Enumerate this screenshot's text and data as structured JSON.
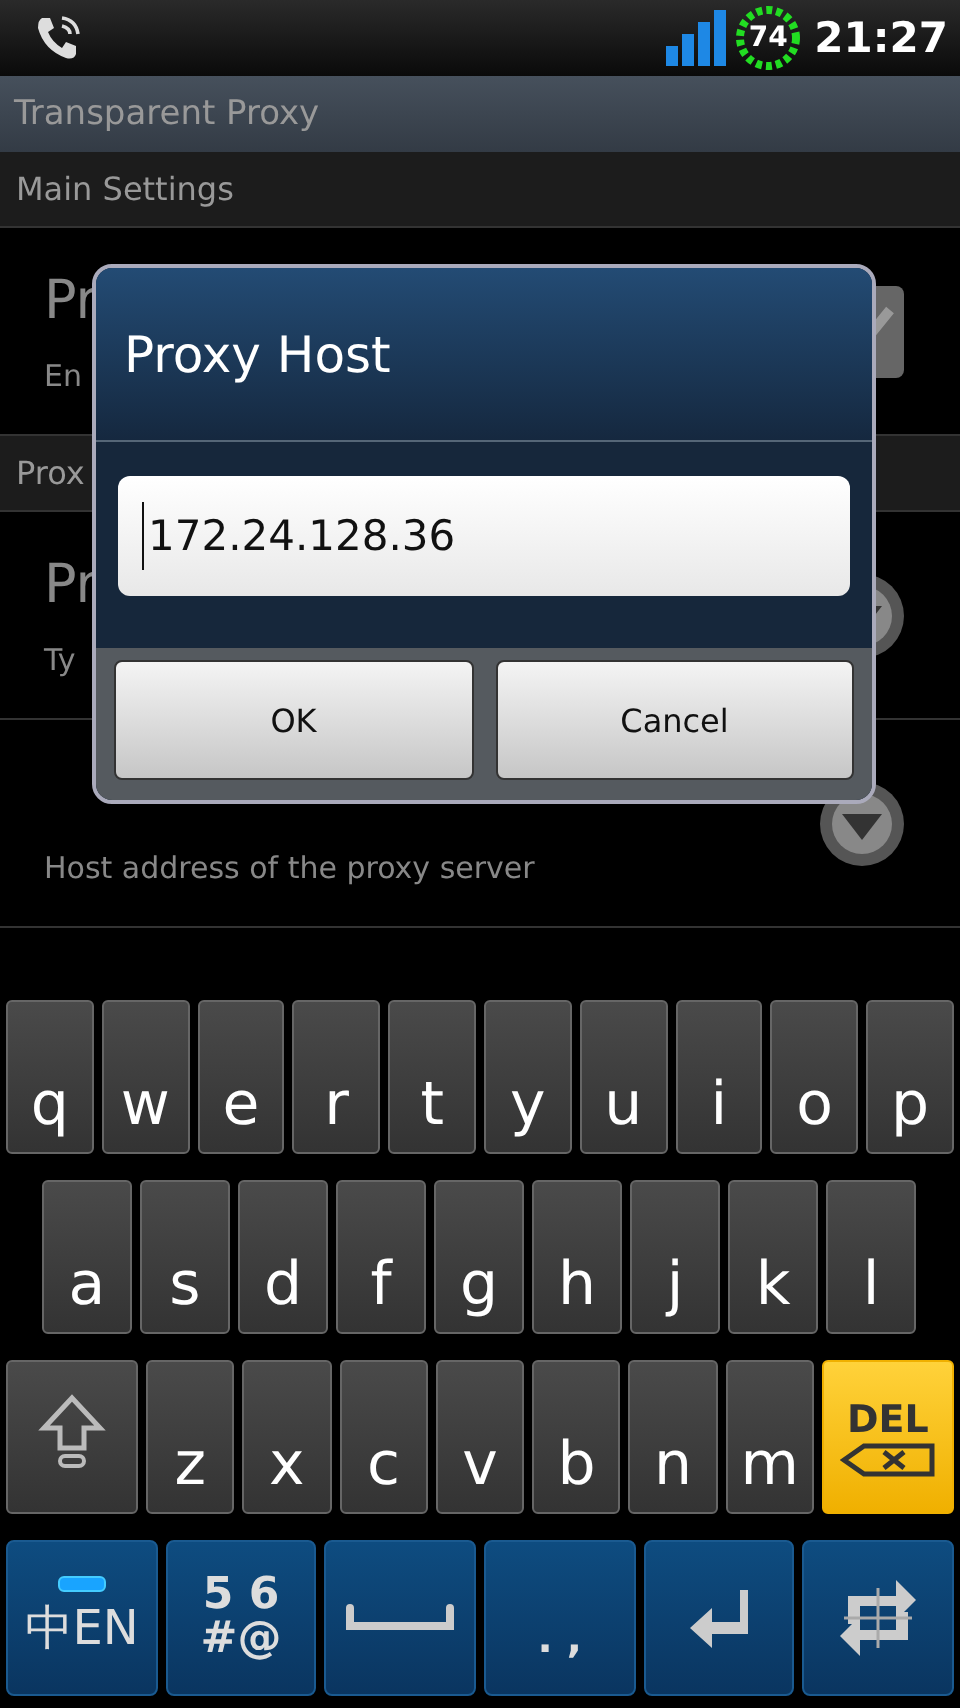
{
  "status_bar": {
    "battery": "74",
    "time": "21:27"
  },
  "app_title": "Transparent Proxy",
  "preferences": [
    {
      "kind": "category",
      "title": "Main Settings"
    },
    {
      "kind": "checkbox",
      "title": "Pr",
      "summary": "En",
      "checked": true
    },
    {
      "kind": "category",
      "title": "Prox"
    },
    {
      "kind": "list",
      "title": "Pr",
      "summary": "Ty"
    },
    {
      "kind": "list",
      "summary": "Host address of the proxy server"
    }
  ],
  "dialog": {
    "title": "Proxy Host",
    "value": "172.24.128.36",
    "buttons": [
      "OK",
      "Cancel"
    ]
  },
  "keyboard": {
    "rows": [
      [
        {
          "kind": "char",
          "label": "q"
        },
        {
          "kind": "char",
          "label": "w"
        },
        {
          "kind": "char",
          "label": "e"
        },
        {
          "kind": "char",
          "label": "r"
        },
        {
          "kind": "char",
          "label": "t"
        },
        {
          "kind": "char",
          "label": "y"
        },
        {
          "kind": "char",
          "label": "u"
        },
        {
          "kind": "char",
          "label": "i"
        },
        {
          "kind": "char",
          "label": "o"
        },
        {
          "kind": "char",
          "label": "p"
        }
      ],
      [
        {
          "kind": "char",
          "label": "a"
        },
        {
          "kind": "char",
          "label": "s"
        },
        {
          "kind": "char",
          "label": "d"
        },
        {
          "kind": "char",
          "label": "f"
        },
        {
          "kind": "char",
          "label": "g"
        },
        {
          "kind": "char",
          "label": "h"
        },
        {
          "kind": "char",
          "label": "j"
        },
        {
          "kind": "char",
          "label": "k"
        },
        {
          "kind": "char",
          "label": "l"
        }
      ],
      [
        {
          "kind": "shift"
        },
        {
          "kind": "char",
          "label": "z"
        },
        {
          "kind": "char",
          "label": "x"
        },
        {
          "kind": "char",
          "label": "c"
        },
        {
          "kind": "char",
          "label": "v"
        },
        {
          "kind": "char",
          "label": "b"
        },
        {
          "kind": "char",
          "label": "n"
        },
        {
          "kind": "char",
          "label": "m"
        },
        {
          "kind": "del",
          "label": "DEL"
        }
      ],
      [
        {
          "kind": "lang",
          "label": "中EN"
        },
        {
          "kind": "symbols",
          "top": "5 6",
          "bottom": "#@"
        },
        {
          "kind": "space"
        },
        {
          "kind": "punct",
          "label": ". ,"
        },
        {
          "kind": "enter"
        },
        {
          "kind": "switch"
        }
      ]
    ]
  }
}
